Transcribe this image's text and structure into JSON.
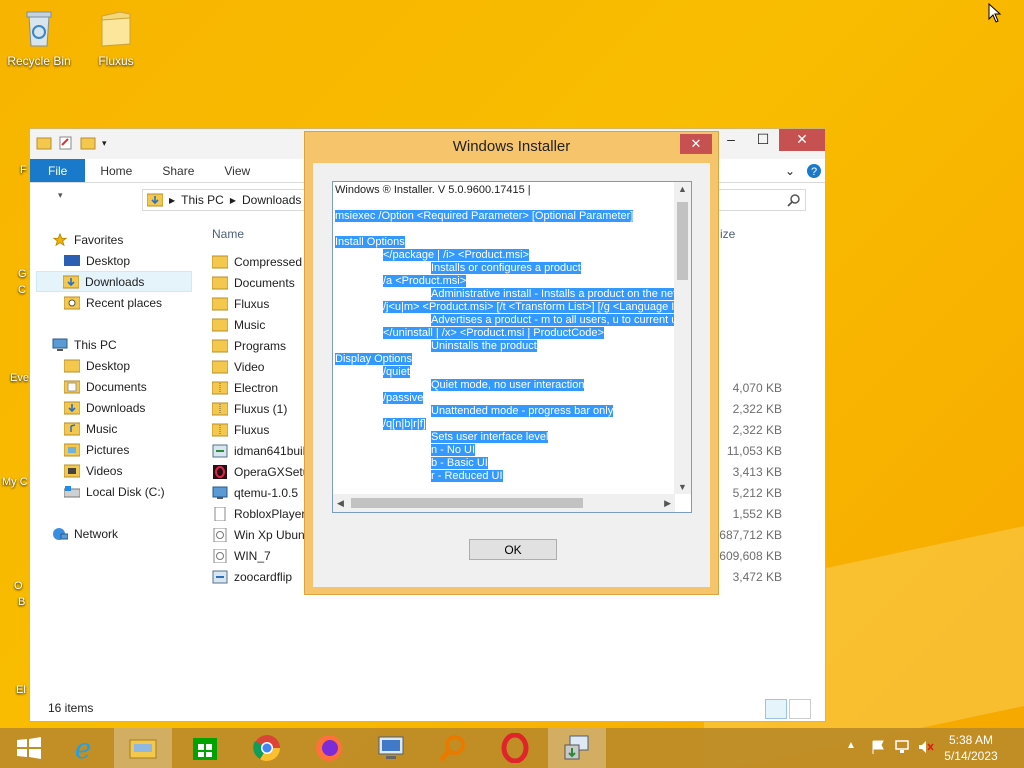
{
  "desktop": {
    "icons": [
      {
        "label": "Recycle Bin",
        "icon": "recycle-bin-icon"
      },
      {
        "label": "Fluxus",
        "icon": "folder-icon"
      }
    ],
    "partial_labels": [
      "F",
      "G",
      "C",
      "Eve",
      "My C",
      "O",
      "B",
      "El"
    ]
  },
  "explorer": {
    "ribbon_tabs": [
      "File",
      "Home",
      "Share",
      "View"
    ],
    "breadcrumb": [
      "This PC",
      "Downloads"
    ],
    "nav": {
      "favorites": "Favorites",
      "favorites_items": [
        "Desktop",
        "Downloads",
        "Recent places"
      ],
      "this_pc": "This PC",
      "this_pc_items": [
        "Desktop",
        "Documents",
        "Downloads",
        "Music",
        "Pictures",
        "Videos",
        "Local Disk (C:)"
      ],
      "network": "Network"
    },
    "columns": {
      "name": "Name",
      "size": "ize"
    },
    "files": [
      {
        "name": "Compressed",
        "size": ""
      },
      {
        "name": "Documents",
        "size": ""
      },
      {
        "name": "Fluxus",
        "size": ""
      },
      {
        "name": "Music",
        "size": ""
      },
      {
        "name": "Programs",
        "size": ""
      },
      {
        "name": "Video",
        "size": ""
      },
      {
        "name": "Electron",
        "size": "4,070 KB"
      },
      {
        "name": "Fluxus (1)",
        "size": "2,322 KB"
      },
      {
        "name": "Fluxus",
        "size": "2,322 KB"
      },
      {
        "name": "idman641buil",
        "size": "11,053 KB"
      },
      {
        "name": "OperaGXSetup",
        "size": "3,413 KB"
      },
      {
        "name": "qtemu-1.0.5",
        "size": "5,212 KB"
      },
      {
        "name": "RobloxPlayerL",
        "size": "1,552 KB"
      },
      {
        "name": "Win Xp Ubunt",
        "size": "687,712 KB"
      },
      {
        "name": "WIN_7",
        "size": "609,608 KB"
      },
      {
        "name": "zoocardflip",
        "size": "3,472 KB"
      }
    ],
    "status": "16 items"
  },
  "dialog": {
    "title": "Windows Installer",
    "close": "✕",
    "ok": "OK",
    "lines": [
      {
        "indent": 0,
        "text": "Windows ® Installer. V 5.0.9600.17415 |",
        "hl": false
      },
      {
        "indent": 0,
        "text": "",
        "hl": false
      },
      {
        "indent": 0,
        "text": "msiexec /Option <Required Parameter> [Optional Parameter]",
        "hl": true
      },
      {
        "indent": 0,
        "text": "",
        "hl": false
      },
      {
        "indent": 0,
        "text": "Install Options",
        "hl": true
      },
      {
        "indent": 1,
        "text": "</package | /i> <Product.msi>",
        "hl": true
      },
      {
        "indent": 2,
        "text": "Installs or configures a product",
        "hl": true
      },
      {
        "indent": 1,
        "text": "/a <Product.msi>",
        "hl": true
      },
      {
        "indent": 2,
        "text": "Administrative install - Installs a product on the netwo",
        "hl": true
      },
      {
        "indent": 1,
        "text": "/j<u|m> <Product.msi> [/t <Transform List>] [/g <Language ID>]",
        "hl": true
      },
      {
        "indent": 2,
        "text": "Advertises a product - m to all users, u to current user",
        "hl": true
      },
      {
        "indent": 1,
        "text": "</uninstall | /x> <Product.msi | ProductCode>",
        "hl": true
      },
      {
        "indent": 2,
        "text": "Uninstalls the product",
        "hl": true
      },
      {
        "indent": 0,
        "text": "Display Options",
        "hl": true
      },
      {
        "indent": 1,
        "text": "/quiet",
        "hl": true
      },
      {
        "indent": 2,
        "text": "Quiet mode, no user interaction",
        "hl": true
      },
      {
        "indent": 1,
        "text": "/passive",
        "hl": true
      },
      {
        "indent": 2,
        "text": "Unattended mode - progress bar only",
        "hl": true
      },
      {
        "indent": 1,
        "text": "/q[n|b|r|f]",
        "hl": true
      },
      {
        "indent": 2,
        "text": "Sets user interface level",
        "hl": true
      },
      {
        "indent": 2,
        "text": "n - No UI",
        "hl": true
      },
      {
        "indent": 2,
        "text": "b - Basic UI",
        "hl": true
      },
      {
        "indent": 2,
        "text": "r - Reduced UI",
        "hl": true
      }
    ]
  },
  "taskbar": {
    "items": [
      "start-button",
      "internet-explorer-icon",
      "file-explorer-icon",
      "store-icon",
      "chrome-icon",
      "firefox-icon",
      "remote-desktop-icon",
      "search-magnifier-icon",
      "opera-icon",
      "windows-installer-icon"
    ],
    "time": "5:38 AM",
    "date": "5/14/2023"
  },
  "colors": {
    "accent": "#1979ca",
    "selection": "#3399ff",
    "dialog_frame": "#f6c46a",
    "close": "#c75050"
  }
}
